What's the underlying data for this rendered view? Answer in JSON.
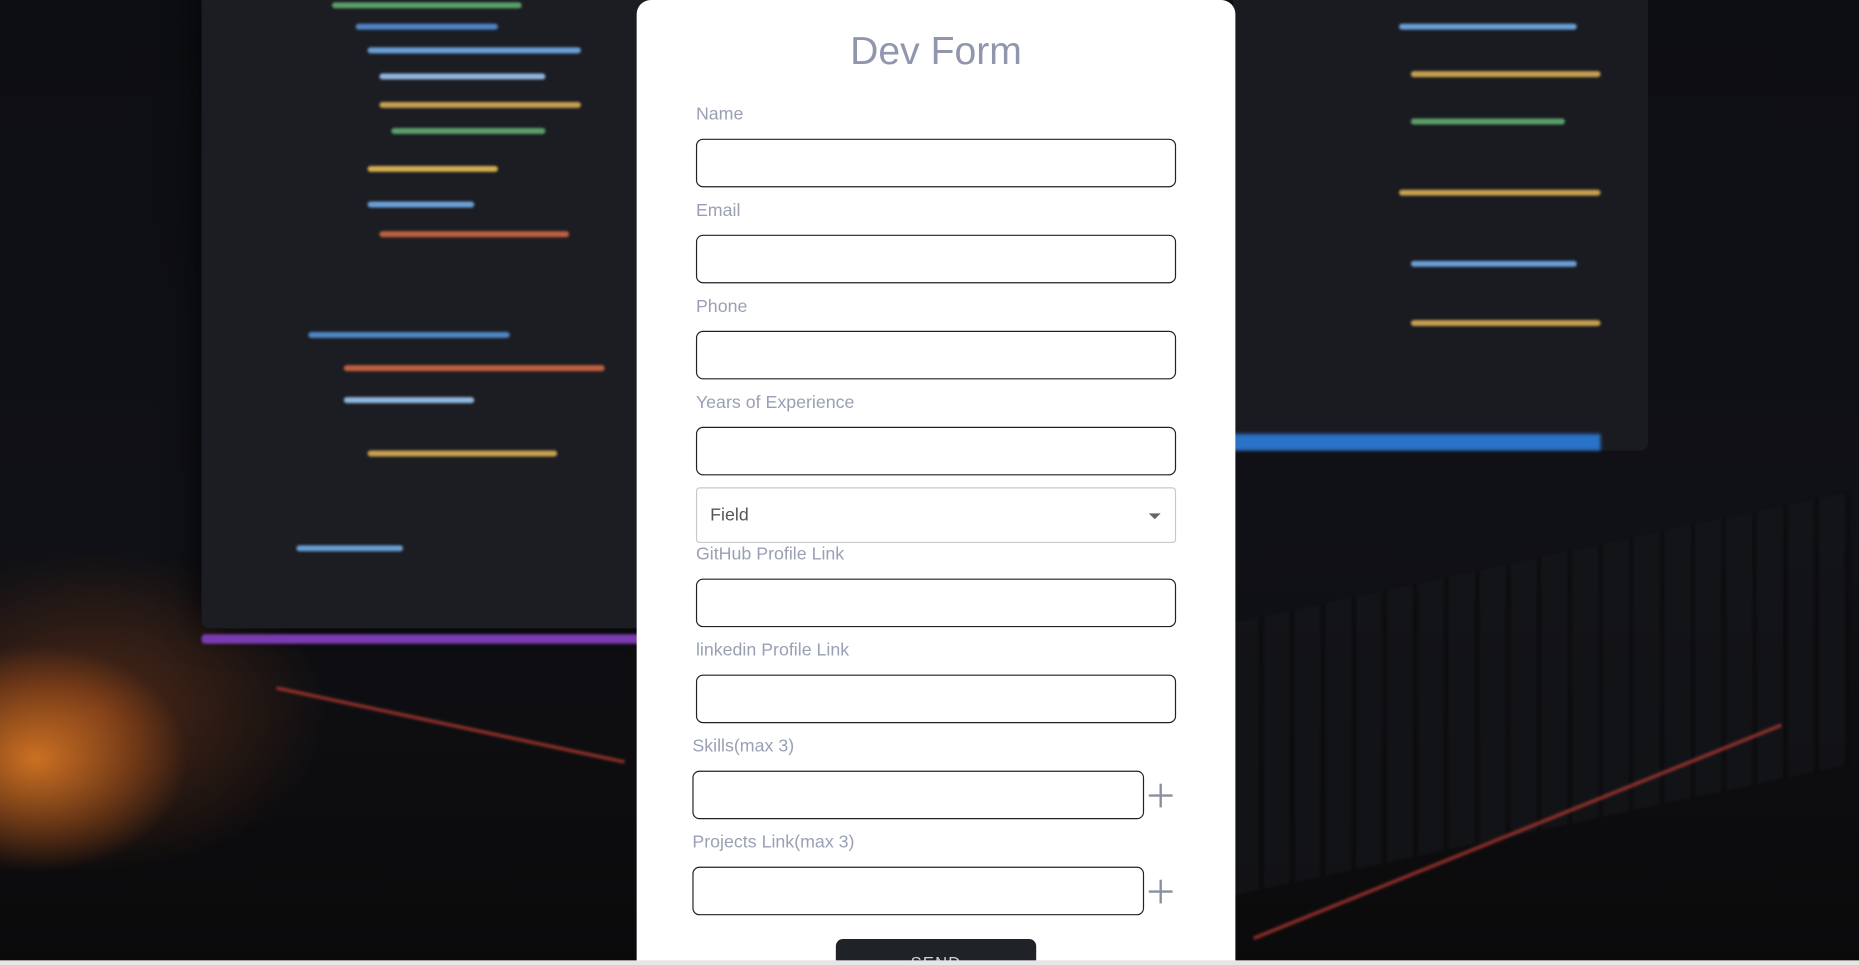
{
  "form": {
    "title": "Dev Form",
    "fields": [
      {
        "label": "Name",
        "value": ""
      },
      {
        "label": "Email",
        "value": ""
      },
      {
        "label": "Phone",
        "value": ""
      },
      {
        "label": "Years of Experience",
        "value": ""
      }
    ],
    "field_select": {
      "selected": "Field"
    },
    "links": [
      {
        "label": "GitHub Profile Link",
        "value": ""
      },
      {
        "label": "linkedin Profile Link",
        "value": ""
      }
    ],
    "skills": {
      "label": "Skills(max 3)",
      "value": ""
    },
    "projects": {
      "label": "Projects Link(max 3)",
      "value": ""
    },
    "send_label": "SEND"
  },
  "icons": {
    "add_skill": "plus-icon",
    "add_project": "plus-icon",
    "select_caret": "caret-down-icon"
  },
  "colors": {
    "title": "#8f96ad",
    "label": "#9aa0b4",
    "send_button": "#1f2227"
  }
}
